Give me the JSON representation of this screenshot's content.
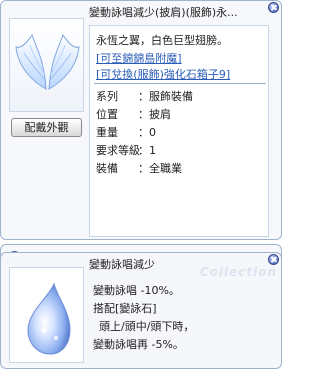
{
  "item_window": {
    "title": "變動詠唱減少(披肩)(服飾)永...",
    "equip_button": "配戴外觀",
    "description": "永恆之翼，白色巨型翅膀。",
    "links": [
      "[可至錦錦島附魔]",
      "[可兌換(服飾)強化石箱子9]"
    ],
    "attributes": [
      {
        "key": "系列",
        "value": "：服飾裝備"
      },
      {
        "key": "位置",
        "value": "：披肩"
      },
      {
        "key": "重量",
        "value": "：0"
      },
      {
        "key": "要求等級",
        "value": "：1"
      },
      {
        "key": "裝備",
        "value": "：全職業"
      }
    ]
  },
  "card_strip": {
    "slots": 3
  },
  "card_window": {
    "title": "變動詠唱減少",
    "watermark": "Collection",
    "lines": [
      "變動詠唱 -10%。",
      "搭配[變詠石]",
      "頭上/頭中/頭下時，",
      "變動詠唱再 -5%。"
    ]
  }
}
